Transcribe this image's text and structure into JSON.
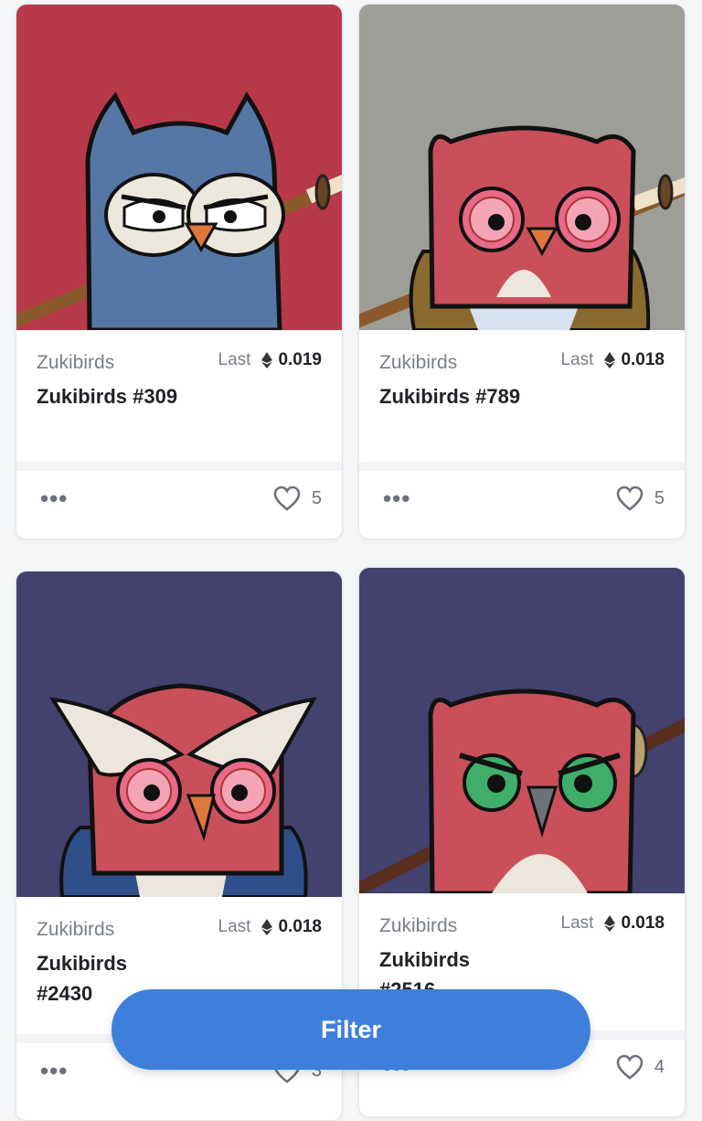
{
  "cards": [
    {
      "collection": "Zukibirds",
      "name": "Zukibirds #309",
      "last_label": "Last",
      "price": "0.019",
      "likes": "5",
      "bg_color": "#b8394a",
      "owl_color": "#5577a6",
      "eye_color": "#ffffff",
      "accessory": "sword"
    },
    {
      "collection": "Zukibirds",
      "name": "Zukibirds #789",
      "last_label": "Last",
      "price": "0.018",
      "likes": "5",
      "bg_color": "#9e9e99",
      "owl_color": "#c9505a",
      "eye_color": "#e86a86",
      "accessory": "sword"
    },
    {
      "collection": "Zukibirds",
      "name": "Zukibirds #2430",
      "last_label": "Last",
      "price": "0.018",
      "likes": "3",
      "bg_color": "#43416e",
      "owl_color": "#c9505a",
      "eye_color": "#e86a86",
      "accessory": "jacket"
    },
    {
      "collection": "Zukibirds",
      "name": "Zukibirds #2516",
      "last_label": "Last",
      "price": "0.018",
      "likes": "4",
      "bg_color": "#43416e",
      "owl_color": "#c9505a",
      "eye_color": "#3fae6a",
      "accessory": "sword"
    }
  ],
  "filter_button": {
    "label": "Filter",
    "color": "#3f7fdc"
  },
  "icons": {
    "more": "ellipsis-icon",
    "like": "heart-icon",
    "currency": "ethereum-icon"
  }
}
